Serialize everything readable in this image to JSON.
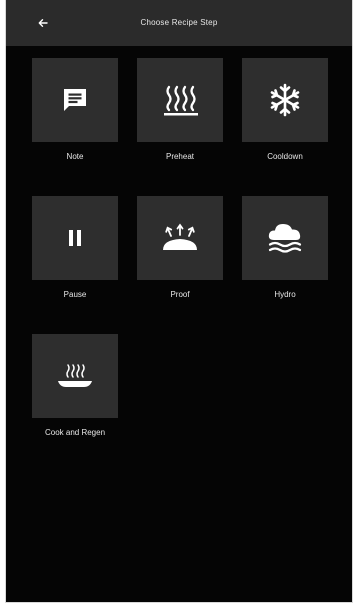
{
  "header": {
    "title": "Choose Recipe Step",
    "back_icon": "back-arrow-icon"
  },
  "steps": [
    {
      "label": "Note",
      "icon": "note-icon"
    },
    {
      "label": "Preheat",
      "icon": "heat-waves-icon"
    },
    {
      "label": "Cooldown",
      "icon": "snowflake-icon"
    },
    {
      "label": "Pause",
      "icon": "pause-icon"
    },
    {
      "label": "Proof",
      "icon": "proof-bread-icon"
    },
    {
      "label": "Hydro",
      "icon": "steam-cloud-icon"
    },
    {
      "label": "Cook and Regen",
      "icon": "cook-regen-plate-icon"
    }
  ],
  "colors": {
    "background": "#050505",
    "header": "#2b2b2b",
    "tile": "#2e2e2e",
    "icon": "#ffffff",
    "text": "#e8e8e8"
  }
}
